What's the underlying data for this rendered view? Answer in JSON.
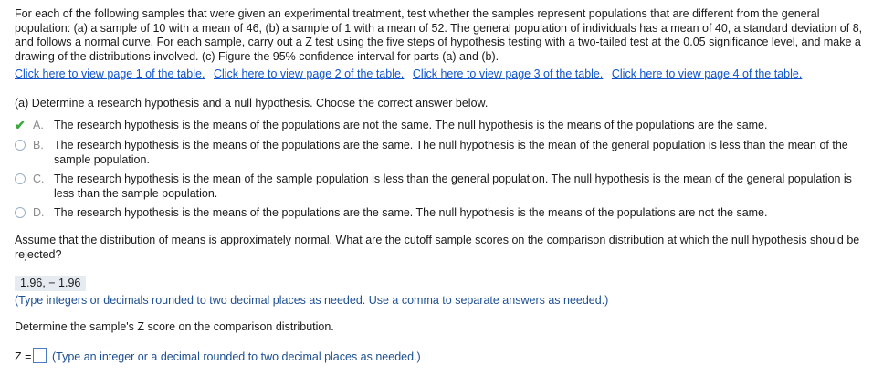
{
  "problem": {
    "text": "For each of the following samples that were given an experimental treatment, test whether the samples represent populations that are different from the general population: (a) a sample of 10 with a mean of 46, (b) a sample of 1 with a mean of 52. The general population of individuals has a mean of 40, a standard deviation of 8, and follows a normal curve. For each sample, carry out a Z test using the five steps of hypothesis testing with a two-tailed test at the 0.05 significance level, and make a drawing of the distributions involved. (c) Figure the 95% confidence interval for parts (a) and (b).",
    "links": [
      "Click here to view page 1 of the table.",
      "Click here to view page 2 of the table.",
      "Click here to view page 3 of the table.",
      "Click here to view page 4 of the table."
    ]
  },
  "part_a": {
    "prompt": "(a) Determine a research hypothesis and a null hypothesis. Choose the correct answer below.",
    "choices": [
      {
        "letter": "A.",
        "text": "The research hypothesis is the means of the populations are not the same. The null hypothesis is the means of the populations are the same.",
        "selected": true
      },
      {
        "letter": "B.",
        "text": "The research hypothesis is the means of the populations are the same. The null hypothesis is the mean of the general population is less than the mean of the sample population.",
        "selected": false
      },
      {
        "letter": "C.",
        "text": "The research hypothesis is the mean of the sample population is less than the general population. The null hypothesis is the mean of the general population is less than the sample population.",
        "selected": false
      },
      {
        "letter": "D.",
        "text": "The research hypothesis is the means of the populations are the same. The null hypothesis is the means of the populations are not the same.",
        "selected": false
      }
    ]
  },
  "cutoff": {
    "question": "Assume that the distribution of means is approximately normal. What are the cutoff sample scores on the comparison distribution at which the null hypothesis should be rejected?",
    "answer": "1.96,  − 1.96",
    "hint": "(Type integers or decimals rounded to two decimal places as needed. Use a comma to separate answers as needed.)"
  },
  "zscore": {
    "question": "Determine the sample's Z score on the comparison distribution.",
    "label": "Z =",
    "value": "",
    "hint": "(Type an integer or a decimal rounded to two decimal places as needed.)"
  },
  "colors": {
    "link": "#1155cc",
    "check": "#3aa83a",
    "answer_bg": "#e6ebf2",
    "hint": "#1d4f91"
  }
}
